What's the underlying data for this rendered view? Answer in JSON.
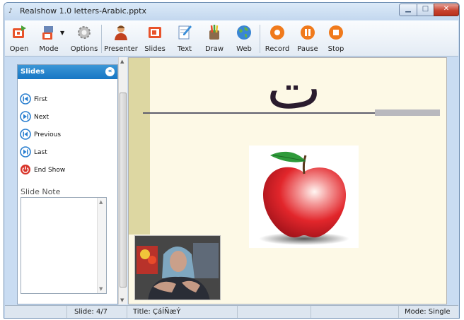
{
  "window": {
    "title": "Realshow 1.0 letters-Arabic.pptx"
  },
  "toolbar": {
    "open": "Open",
    "mode": "Mode",
    "options": "Options",
    "presenter": "Presenter",
    "slides": "Slides",
    "text": "Text",
    "draw": "Draw",
    "web": "Web",
    "record": "Record",
    "pause": "Pause",
    "stop": "Stop"
  },
  "sidebar": {
    "title": "Slides",
    "items": [
      {
        "label": "First",
        "icon": "first-icon"
      },
      {
        "label": "Next",
        "icon": "next-icon"
      },
      {
        "label": "Previous",
        "icon": "previous-icon"
      },
      {
        "label": "Last",
        "icon": "last-icon"
      },
      {
        "label": "End Show",
        "icon": "power-icon"
      }
    ],
    "note_label": "Slide Note"
  },
  "slide": {
    "letter": "ت"
  },
  "status": {
    "slide": "Slide: 4/7",
    "title": "Title: ÇáÍÑæÝ",
    "mode": "Mode: Single"
  },
  "colors": {
    "accent": "#1776c4",
    "slide_background": "#fdf9e6",
    "slide_band": "#ddd7a2",
    "record_orange": "#f07a1c"
  }
}
